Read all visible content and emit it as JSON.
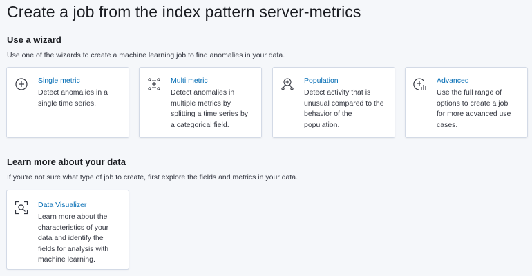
{
  "page": {
    "title": "Create a job from the index pattern server-metrics"
  },
  "wizard_section": {
    "title": "Use a wizard",
    "description": "Use one of the wizards to create a machine learning job to find anomalies in your data.",
    "cards": [
      {
        "title": "Single metric",
        "icon": "plus-circle-icon",
        "desc_lines": [
          "Detect anomalies in a",
          "single time series."
        ]
      },
      {
        "title": "Multi metric",
        "icon": "multi-metric-icon",
        "desc_lines": [
          "Detect anomalies in",
          "multiple metrics by",
          "splitting a time series by",
          "a categorical field."
        ]
      },
      {
        "title": "Population",
        "icon": "population-icon",
        "desc_lines": [
          "Detect activity that is",
          "unusual compared to the",
          "behavior of the",
          "population."
        ]
      },
      {
        "title": "Advanced",
        "icon": "advanced-icon",
        "desc_lines": [
          "Use the full range of",
          "options to create a job",
          "for more advanced use",
          "cases."
        ]
      }
    ]
  },
  "learn_section": {
    "title": "Learn more about your data",
    "description": "If you're not sure what type of job to create, first explore the fields and metrics in your data.",
    "cards": [
      {
        "title": "Data Visualizer",
        "icon": "data-visualizer-icon",
        "desc_lines": [
          "Learn more about the",
          "characteristics of your",
          "data and identify the",
          "fields for analysis with",
          "machine learning."
        ]
      }
    ]
  },
  "colors": {
    "link": "#006bb4",
    "icon": "#343741",
    "background": "#f5f7fa",
    "card_border": "#d3dae6"
  }
}
